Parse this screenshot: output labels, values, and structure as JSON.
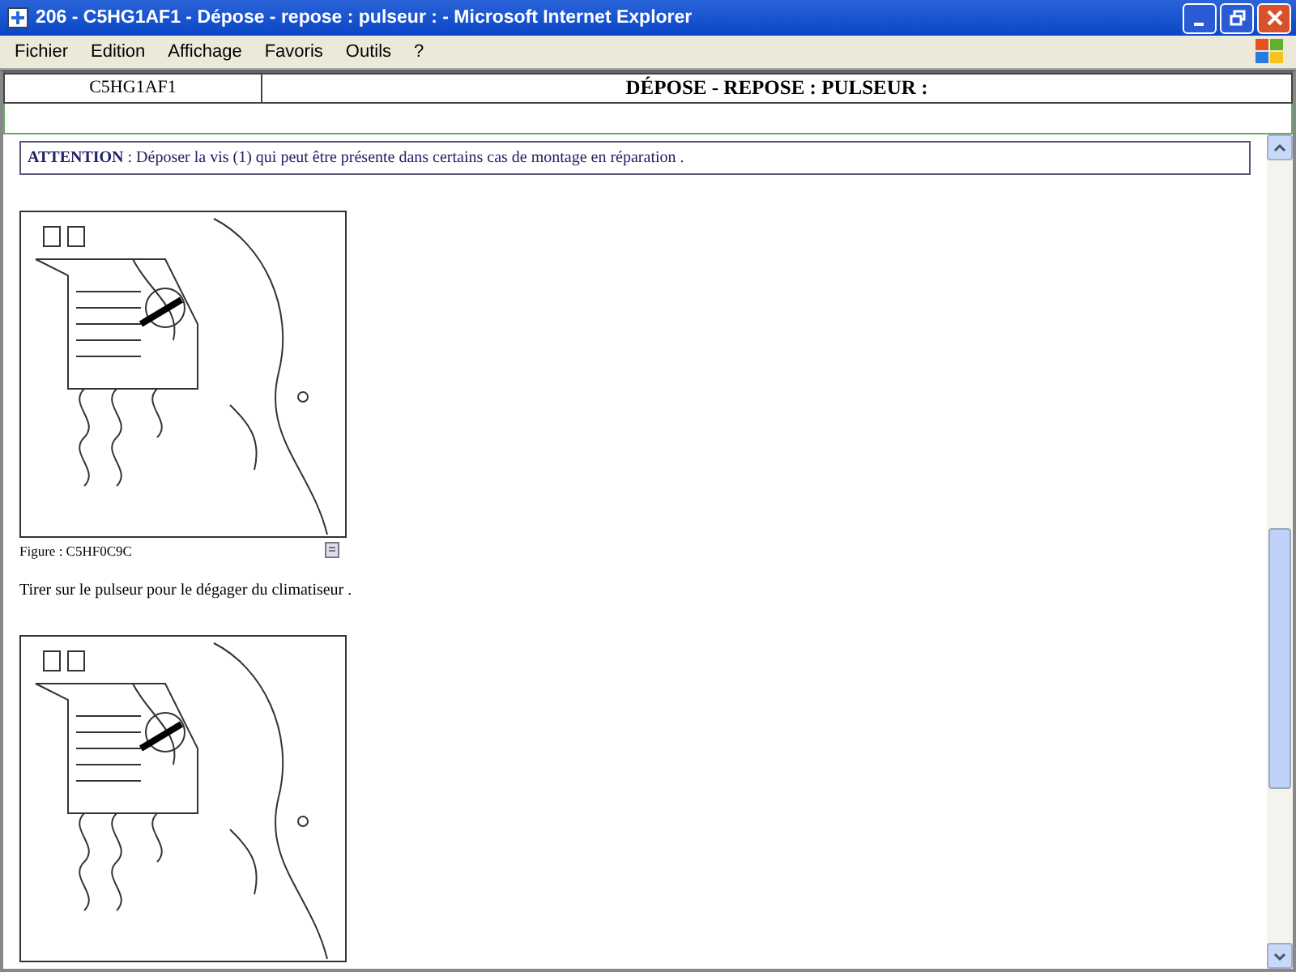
{
  "window": {
    "title": "206 - C5HG1AF1 - Dépose - repose : pulseur : - Microsoft Internet Explorer"
  },
  "menu": [
    "Fichier",
    "Edition",
    "Affichage",
    "Favoris",
    "Outils",
    "?"
  ],
  "header": {
    "code": "C5HG1AF1",
    "title": "DÉPOSE - REPOSE : PULSEUR :"
  },
  "attention": "**ATTENTION** : Déposer la vis (1) qui peut être présente dans certains cas de montage en réparation .",
  "blocks": [
    {
      "kind": "figure",
      "caption": "Figure : C5HF0C9C"
    },
    {
      "kind": "text",
      "text": "Tirer sur le pulseur pour le dégager du climatiseur ."
    },
    {
      "kind": "figure"
    }
  ]
}
